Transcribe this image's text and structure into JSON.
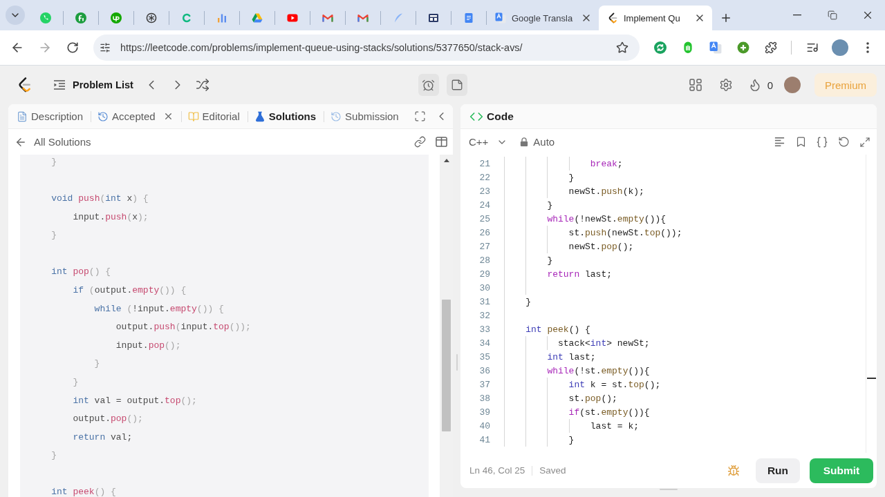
{
  "browser": {
    "tabs": [
      {
        "selected": false
      },
      {
        "selected": false
      },
      {
        "selected": false
      },
      {
        "selected": false
      },
      {
        "selected": false
      },
      {
        "selected": false
      },
      {
        "selected": false
      },
      {
        "selected": false
      },
      {
        "selected": false
      },
      {
        "selected": false
      },
      {
        "selected": false
      },
      {
        "selected": false
      },
      {
        "selected": false
      },
      {
        "title": "Google Transla",
        "selected": false
      },
      {
        "title": "Implement Qu",
        "selected": true
      }
    ],
    "url": "https://leetcode.com/problems/implement-queue-using-stacks/solutions/5377650/stack-avs/"
  },
  "header": {
    "problem_list": "Problem List",
    "streak": "0",
    "premium": "Premium"
  },
  "left_panel": {
    "tabs": [
      {
        "label": "Description",
        "selected": false,
        "closable": false
      },
      {
        "label": "Accepted",
        "selected": false,
        "closable": true
      },
      {
        "label": "Editorial",
        "selected": false,
        "closable": false
      },
      {
        "label": "Solutions",
        "selected": true,
        "closable": false
      },
      {
        "label": "Submission",
        "selected": false,
        "closable": false
      }
    ],
    "back_link": "All Solutions",
    "code_lines": [
      {
        "kind": "code",
        "tokens": [
          {
            "text": "    }",
            "kind": "punct"
          }
        ]
      },
      {
        "kind": "blank"
      },
      {
        "kind": "code",
        "tokens": [
          {
            "text": "    void",
            "kind": "keyword"
          },
          {
            "text": " push",
            "kind": "function"
          },
          {
            "text": "(",
            "kind": "punct"
          },
          {
            "text": "int",
            "kind": "keyword"
          },
          {
            "text": " x",
            "kind": "name"
          },
          {
            "text": ") {",
            "kind": "punct"
          }
        ]
      },
      {
        "kind": "code",
        "tokens": [
          {
            "text": "        input.",
            "kind": "name"
          },
          {
            "text": "push",
            "kind": "function"
          },
          {
            "text": "(",
            "kind": "punct"
          },
          {
            "text": "x",
            "kind": "name"
          },
          {
            "text": ");",
            "kind": "punct"
          }
        ]
      },
      {
        "kind": "code",
        "tokens": [
          {
            "text": "    }",
            "kind": "punct"
          }
        ]
      },
      {
        "kind": "blank"
      },
      {
        "kind": "code",
        "tokens": [
          {
            "text": "    int",
            "kind": "keyword"
          },
          {
            "text": " pop",
            "kind": "function"
          },
          {
            "text": "() {",
            "kind": "punct"
          }
        ]
      },
      {
        "kind": "code",
        "tokens": [
          {
            "text": "        if",
            "kind": "keyword"
          },
          {
            "text": " (",
            "kind": "punct"
          },
          {
            "text": "output.",
            "kind": "name"
          },
          {
            "text": "empty",
            "kind": "function"
          },
          {
            "text": "()) {",
            "kind": "punct"
          }
        ]
      },
      {
        "kind": "code",
        "tokens": [
          {
            "text": "            while",
            "kind": "keyword"
          },
          {
            "text": " (",
            "kind": "punct"
          },
          {
            "text": "!input.",
            "kind": "name"
          },
          {
            "text": "empty",
            "kind": "function"
          },
          {
            "text": "()) {",
            "kind": "punct"
          }
        ]
      },
      {
        "kind": "code",
        "tokens": [
          {
            "text": "                output.",
            "kind": "name"
          },
          {
            "text": "push",
            "kind": "function"
          },
          {
            "text": "(",
            "kind": "punct"
          },
          {
            "text": "input.",
            "kind": "name"
          },
          {
            "text": "top",
            "kind": "function"
          },
          {
            "text": "());",
            "kind": "punct"
          }
        ]
      },
      {
        "kind": "code",
        "tokens": [
          {
            "text": "                input.",
            "kind": "name"
          },
          {
            "text": "pop",
            "kind": "function"
          },
          {
            "text": "();",
            "kind": "punct"
          }
        ]
      },
      {
        "kind": "code",
        "tokens": [
          {
            "text": "            }",
            "kind": "punct"
          }
        ]
      },
      {
        "kind": "code",
        "tokens": [
          {
            "text": "        }",
            "kind": "punct"
          }
        ]
      },
      {
        "kind": "code",
        "tokens": [
          {
            "text": "        int",
            "kind": "keyword"
          },
          {
            "text": " val = output.",
            "kind": "name"
          },
          {
            "text": "top",
            "kind": "function"
          },
          {
            "text": "();",
            "kind": "punct"
          }
        ]
      },
      {
        "kind": "code",
        "tokens": [
          {
            "text": "        output.",
            "kind": "name"
          },
          {
            "text": "pop",
            "kind": "function"
          },
          {
            "text": "();",
            "kind": "punct"
          }
        ]
      },
      {
        "kind": "code",
        "tokens": [
          {
            "text": "        return",
            "kind": "keyword"
          },
          {
            "text": " val;",
            "kind": "name"
          }
        ]
      },
      {
        "kind": "code",
        "tokens": [
          {
            "text": "    }",
            "kind": "punct"
          }
        ]
      },
      {
        "kind": "blank"
      },
      {
        "kind": "code",
        "tokens": [
          {
            "text": "    int",
            "kind": "keyword"
          },
          {
            "text": " peek",
            "kind": "function"
          },
          {
            "text": "() {",
            "kind": "punct"
          }
        ]
      }
    ]
  },
  "editor": {
    "title": "Code",
    "language": "C++",
    "mode": "Auto",
    "lines": [
      {
        "number": "21",
        "tokens": [
          {
            "text": "                break",
            "kind": "control"
          },
          {
            "text": ";",
            "kind": "name"
          }
        ]
      },
      {
        "number": "22",
        "tokens": [
          {
            "text": "            }",
            "kind": "name"
          }
        ]
      },
      {
        "number": "23",
        "tokens": [
          {
            "text": "            newSt.",
            "kind": "name"
          },
          {
            "text": "push",
            "kind": "function"
          },
          {
            "text": "(k);",
            "kind": "name"
          }
        ]
      },
      {
        "number": "24",
        "tokens": [
          {
            "text": "        }",
            "kind": "name"
          }
        ]
      },
      {
        "number": "25",
        "tokens": [
          {
            "text": "        while",
            "kind": "control"
          },
          {
            "text": "(!newSt.",
            "kind": "name"
          },
          {
            "text": "empty",
            "kind": "function"
          },
          {
            "text": "()){",
            "kind": "name"
          }
        ]
      },
      {
        "number": "26",
        "tokens": [
          {
            "text": "            st.",
            "kind": "name"
          },
          {
            "text": "push",
            "kind": "function"
          },
          {
            "text": "(newSt.",
            "kind": "name"
          },
          {
            "text": "top",
            "kind": "function"
          },
          {
            "text": "());",
            "kind": "name"
          }
        ]
      },
      {
        "number": "27",
        "tokens": [
          {
            "text": "            newSt.",
            "kind": "name"
          },
          {
            "text": "pop",
            "kind": "function"
          },
          {
            "text": "();",
            "kind": "name"
          }
        ]
      },
      {
        "number": "28",
        "tokens": [
          {
            "text": "        }",
            "kind": "name"
          }
        ]
      },
      {
        "number": "29",
        "tokens": [
          {
            "text": "        return",
            "kind": "control"
          },
          {
            "text": " last;",
            "kind": "name"
          }
        ]
      },
      {
        "number": "30"
      },
      {
        "number": "31",
        "tokens": [
          {
            "text": "    }",
            "kind": "name"
          }
        ]
      },
      {
        "number": "32"
      },
      {
        "number": "33",
        "tokens": [
          {
            "text": "    int",
            "kind": "type"
          },
          {
            "text": " peek",
            "kind": "function"
          },
          {
            "text": "() {",
            "kind": "name"
          }
        ]
      },
      {
        "number": "34",
        "tokens": [
          {
            "text": "          stack<",
            "kind": "name"
          },
          {
            "text": "int",
            "kind": "type"
          },
          {
            "text": "> newSt;",
            "kind": "name"
          }
        ]
      },
      {
        "number": "35",
        "tokens": [
          {
            "text": "        int",
            "kind": "type"
          },
          {
            "text": " last;",
            "kind": "name"
          }
        ]
      },
      {
        "number": "36",
        "tokens": [
          {
            "text": "        while",
            "kind": "control"
          },
          {
            "text": "(!st.",
            "kind": "name"
          },
          {
            "text": "empty",
            "kind": "function"
          },
          {
            "text": "()){",
            "kind": "name"
          }
        ]
      },
      {
        "number": "37",
        "tokens": [
          {
            "text": "            int",
            "kind": "type"
          },
          {
            "text": " k = st.",
            "kind": "name"
          },
          {
            "text": "top",
            "kind": "function"
          },
          {
            "text": "();",
            "kind": "name"
          }
        ]
      },
      {
        "number": "38",
        "tokens": [
          {
            "text": "            st.",
            "kind": "name"
          },
          {
            "text": "pop",
            "kind": "function"
          },
          {
            "text": "();",
            "kind": "name"
          }
        ]
      },
      {
        "number": "39",
        "tokens": [
          {
            "text": "            if",
            "kind": "control"
          },
          {
            "text": "(st.",
            "kind": "name"
          },
          {
            "text": "empty",
            "kind": "function"
          },
          {
            "text": "()){",
            "kind": "name"
          }
        ]
      },
      {
        "number": "40",
        "tokens": [
          {
            "text": "                last = k;",
            "kind": "name"
          }
        ]
      },
      {
        "number": "41",
        "tokens": [
          {
            "text": "            }",
            "kind": "name"
          }
        ]
      }
    ],
    "cursor_position": "Ln 46, Col 25",
    "save_state": "Saved",
    "run": "Run",
    "submit": "Submit"
  }
}
